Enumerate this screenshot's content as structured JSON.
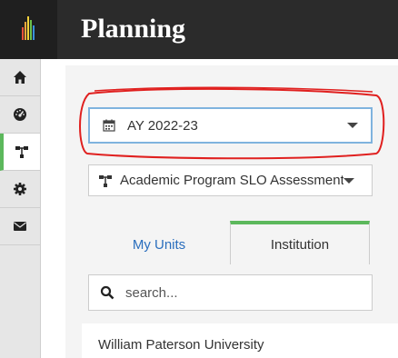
{
  "header": {
    "title": "Planning"
  },
  "sidebar": {
    "items": [
      {
        "name": "home"
      },
      {
        "name": "dashboard"
      },
      {
        "name": "planning",
        "active": true
      },
      {
        "name": "settings"
      },
      {
        "name": "messages"
      }
    ]
  },
  "filters": {
    "year": {
      "value": "AY 2022-23",
      "icon": "calendar-icon"
    },
    "plan": {
      "value": "Academic Program SLO Assessment",
      "icon": "sitemap-icon"
    }
  },
  "tabs": [
    {
      "label": "My Units",
      "active": false
    },
    {
      "label": "Institution",
      "active": true
    }
  ],
  "search": {
    "placeholder": "search..."
  },
  "units": [
    {
      "label": "William Paterson University"
    }
  ],
  "colors": {
    "accent": "#5cb85c",
    "link": "#2a6ebd",
    "annotation": "#e0201f",
    "topbar": "#2b2b2b"
  }
}
